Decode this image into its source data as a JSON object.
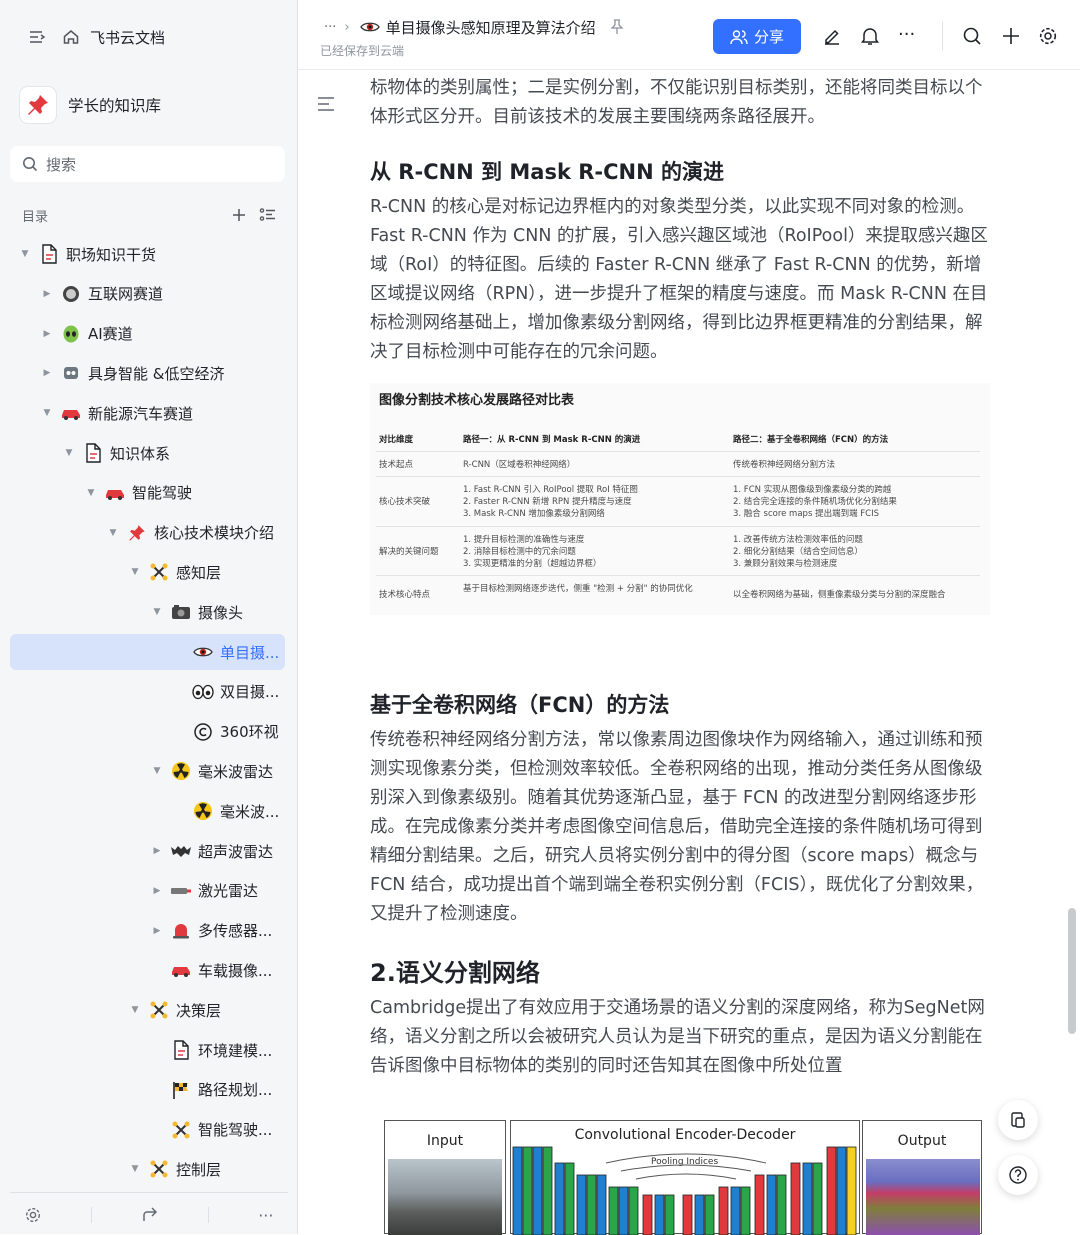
{
  "sidebar": {
    "app_title": "飞书云文档",
    "kb_title": "学长的知识库",
    "search_placeholder": "搜索",
    "toc_label": "目录",
    "tree": [
      {
        "label": "职场知识干货",
        "icon": "doc-icon"
      },
      {
        "label": "互联网赛道",
        "icon": "coin-icon"
      },
      {
        "label": "AI赛道",
        "icon": "alien-icon"
      },
      {
        "label": "具身智能 &低空经济",
        "icon": "robot-icon"
      },
      {
        "label": "新能源汽车赛道",
        "icon": "car-icon"
      },
      {
        "label": "知识体系",
        "icon": "doc-icon"
      },
      {
        "label": "智能驾驶",
        "icon": "car-icon"
      },
      {
        "label": "核心技术模块介绍",
        "icon": "pin-icon"
      },
      {
        "label": "感知层",
        "icon": "network-icon"
      },
      {
        "label": "摄像头",
        "icon": "camera-icon"
      },
      {
        "label": "单目摄...",
        "icon": "eye-icon"
      },
      {
        "label": "双目摄...",
        "icon": "eyes-icon"
      },
      {
        "label": "360环视",
        "icon": "copyright-icon"
      },
      {
        "label": "毫米波雷达",
        "icon": "radiation-icon"
      },
      {
        "label": "毫米波...",
        "icon": "radiation-icon"
      },
      {
        "label": "超声波雷达",
        "icon": "bat-icon"
      },
      {
        "label": "激光雷达",
        "icon": "laser-icon"
      },
      {
        "label": "多传感器...",
        "icon": "bell-icon"
      },
      {
        "label": "车载摄像...",
        "icon": "car-icon"
      },
      {
        "label": "决策层",
        "icon": "network-icon"
      },
      {
        "label": "环境建模...",
        "icon": "doc-icon"
      },
      {
        "label": "路径规划...",
        "icon": "flag-icon"
      },
      {
        "label": "智能驾驶...",
        "icon": "network-icon"
      },
      {
        "label": "控制层",
        "icon": "network-icon"
      }
    ]
  },
  "header": {
    "doc_title": "单目摄像头感知原理及算法介绍",
    "save_status": "已经保存到云端",
    "share_label": "分享",
    "more_label": "···"
  },
  "content": {
    "intro": "标物体的类别属性；二是实例分割，不仅能识别目标类别，还能将同类目标以个体形式区分开。目前该技术的发展主要围绕两条路径展开。",
    "h_rcnn": "从 R-CNN 到 Mask R-CNN 的演进",
    "p_rcnn": "R-CNN 的核心是对标记边界框内的对象类型分类，以此实现不同对象的检测。Fast R-CNN 作为 CNN 的扩展，引入感兴趣区域池（RoIPool）来提取感兴趣区域（RoI）的特征图。后续的 Faster R-CNN 继承了 Fast R-CNN 的优势，新增区域提议网络（RPN），进一步提升了框架的精度与速度。而 Mask R-CNN 在目标检测网络基础上，增加像素级分割网络，得到比边界框更精准的分割结果，解决了目标检测中可能存在的冗余问题。",
    "table": {
      "title": "图像分割技术核心发展路径对比表",
      "headers": [
        "对比维度",
        "路径一：从 R-CNN 到 Mask R-CNN 的演进",
        "路径二：基于全卷积网络（FCN）的方法"
      ],
      "rows": [
        [
          "技术起点",
          "R-CNN（区域卷积神经网络）",
          "传统卷积神经网络分割方法"
        ],
        [
          "核心技术突破",
          "1. Fast R-CNN 引入 RoIPool 提取 RoI 特征图\n2. Faster R-CNN 新增 RPN 提升精度与速度\n3. Mask R-CNN 增加像素级分割网络",
          "1. FCN 实现从图像级到像素级分类的跨越\n2. 结合完全连接的条件随机场优化分割结果\n3. 融合 score maps 提出端到端 FCIS"
        ],
        [
          "解决的关键问题",
          "1. 提升目标检测的准确性与速度\n2. 消除目标检测中的冗余问题\n3. 实现更精准的分割（超越边界框）",
          "1. 改善传统方法检测效率低的问题\n2. 细化分割结果（结合空间信息）\n3. 兼顾分割效果与检测速度"
        ],
        [
          "技术核心特点",
          "基于目标检测网络逐步迭代，侧重 \"检测 + 分割\" 的协同优化",
          "以全卷积网络为基础，侧重像素级分类与分割的深度融合"
        ]
      ]
    },
    "h_fcn": "基于全卷积网络（FCN）的方法",
    "p_fcn": "传统卷积神经网络分割方法，常以像素周边图像块作为网络输入，通过训练和预测实现像素分类，但检测效率较低。全卷积网络的出现，推动分类任务从图像级别深入到像素级别。随着其优势逐渐凸显，基于 FCN 的改进型分割网络逐步形成。在完成像素分类并考虑图像空间信息后，借助完全连接的条件随机场可得到精细分割结果。之后，研究人员将实例分割中的得分图（score maps）概念与 FCN 结合，成功提出首个端到端全卷积实例分割（FCIS），既优化了分割效果，又提升了检测速度。",
    "h_semantic": "2.语义分割网络",
    "p_semantic": "Cambridge提出了有效应用于交通场景的语义分割的深度网络，称为SegNet网络，语义分割之所以会被研究人员认为是当下研究的重点，是因为语义分割能在告诉图像中目标物体的类别的同时还告知其在图像中所处位置",
    "diagram": {
      "input_label": "Input",
      "center_label": "Convolutional Encoder-Decoder",
      "pooling_label": "Pooling Indices",
      "output_label": "Output"
    }
  },
  "colors": {
    "accent": "#3370ff",
    "sidebar_bg": "#f5f6f7",
    "active_bg": "#d7e2fb"
  }
}
